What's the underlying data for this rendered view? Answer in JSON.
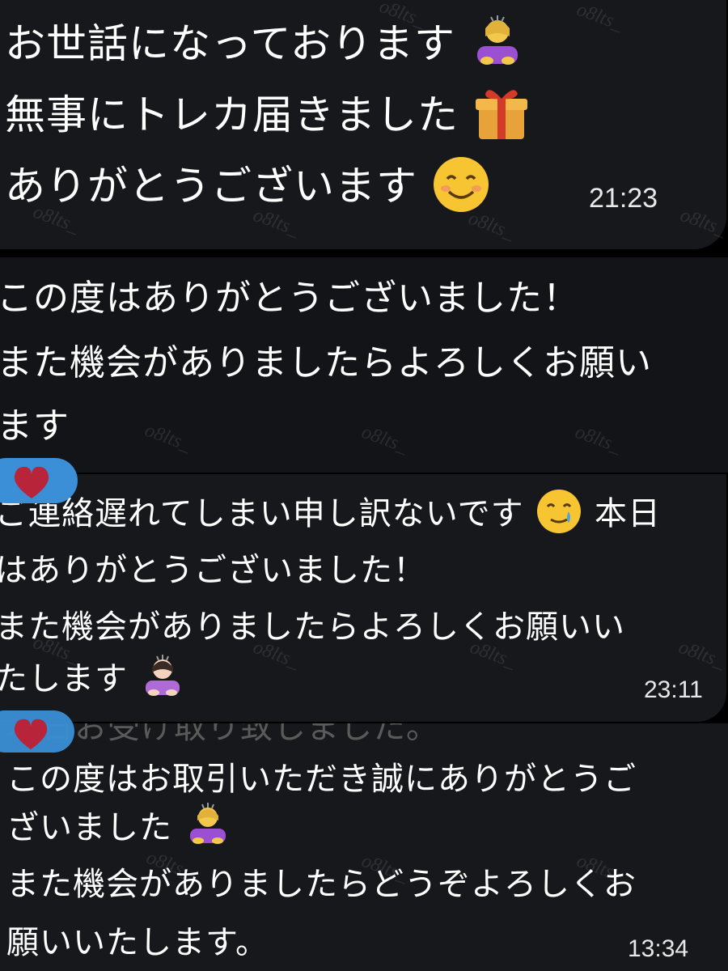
{
  "watermark": "o8lts_",
  "messages": [
    {
      "lines": [
        "お世話になっております",
        "無事にトレカ届きました",
        "ありがとうございます"
      ],
      "emojis": [
        "person-bowing-emoji",
        "gift-emoji",
        "smiling-face-emoji"
      ],
      "time": "21:23"
    },
    {
      "lines": [
        "この度はありがとうございました！",
        "また機会がありましたらよろしくお願い",
        "ます"
      ],
      "time": ""
    },
    {
      "lines": [
        "ご連絡遅れてしまい申し訳ないです",
        "本日",
        "はありがとうございました！",
        "また機会がありましたらよろしくお願いい",
        "たします"
      ],
      "emojis": [
        "smiling-face-with-tear-emoji",
        "person-bowing-emoji"
      ],
      "time": "23:11",
      "reaction": "heart-reaction"
    },
    {
      "overlap_line": "本日お受け取り致しました。",
      "lines": [
        "この度はお取引いただき誠にありがとうご",
        "ざいました",
        "また機会がありましたらどうぞよろしくお",
        "願いいたします。"
      ],
      "emojis": [
        "person-bowing-emoji"
      ],
      "time": "13:34",
      "reaction": "heart-reaction"
    }
  ],
  "colors": {
    "background": "#000000",
    "bubble": "#16181b",
    "bubble_alt": "#121417",
    "reaction_bubble": "#3a8fd6",
    "heart": "#b8243a",
    "text": "#ffffff"
  }
}
